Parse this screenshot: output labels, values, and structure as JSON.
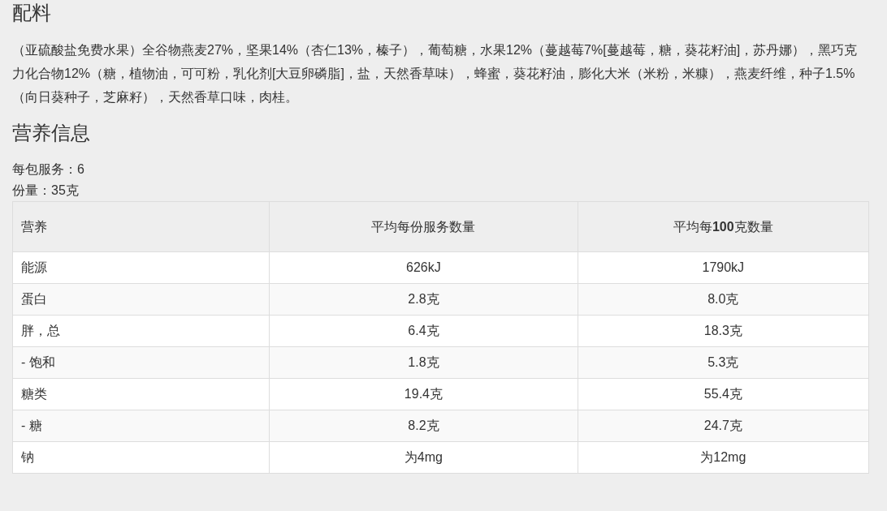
{
  "ingredients": {
    "title": "配料",
    "text": "（亚硫酸盐免费水果）全谷物燕麦27%，坚果14%（杏仁13%，榛子），葡萄糖，水果12%（蔓越莓7%[蔓越莓，糖，葵花籽油]，苏丹娜），黑巧克力化合物12%（糖，植物油，可可粉，乳化剂[大豆卵磷脂]，盐，天然香草味），蜂蜜，葵花籽油，膨化大米（米粉，米糠），燕麦纤维，种子1.5%（向日葵种子，芝麻籽），天然香草口味，肉桂。"
  },
  "nutrition": {
    "title": "营养信息",
    "servings_per_pack": "每包服务：6",
    "serving_size": "份量：35克",
    "table": {
      "columns": [
        "营养",
        "平均每份服务数量",
        "平均每**100**克数量"
      ],
      "rows": [
        [
          "能源",
          "626kJ",
          "1790kJ"
        ],
        [
          "蛋白",
          "2.8克",
          "8.0克"
        ],
        [
          "胖，总",
          "6.4克",
          "18.3克"
        ],
        [
          "- 饱和",
          "1.8克",
          "5.3克"
        ],
        [
          "糖类",
          "19.4克",
          "55.4克"
        ],
        [
          "- 糖",
          "8.2克",
          "24.7克"
        ],
        [
          "钠",
          "为4mg",
          "为12mg"
        ]
      ]
    }
  }
}
